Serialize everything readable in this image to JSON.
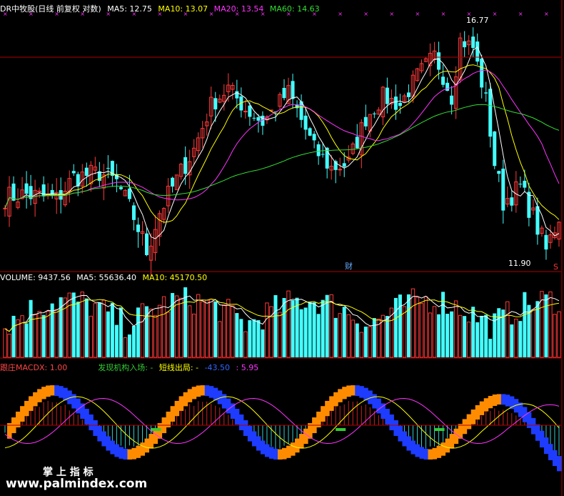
{
  "price_panel": {
    "title": "DR中牧股(日线 前复权 对数)",
    "legend": [
      {
        "label": "MA5: 12.75",
        "color": "#ffffff"
      },
      {
        "label": "MA10: 13.07",
        "color": "#ffff00"
      },
      {
        "label": "MA20: 13.54",
        "color": "#ff33ff"
      },
      {
        "label": "MA60: 14.63",
        "color": "#33dd33"
      }
    ],
    "high_label": "16.77",
    "low_label": "11.90",
    "finance_marker": "财",
    "corner_marker": "S"
  },
  "volume_panel": {
    "legend": [
      {
        "label": "VOLUME: 9437.56",
        "color": "#ffffff"
      },
      {
        "label": "MA5: 55636.40",
        "color": "#ffffff"
      },
      {
        "label": "MA10: 45170.50",
        "color": "#ffff00"
      }
    ]
  },
  "indicator_panel": {
    "legend": [
      {
        "label": "跟庄MACDX: 1.00",
        "color": "#ff4444"
      },
      {
        "label": "发现机构入场: -",
        "color": "#33cc33"
      },
      {
        "label": "短线出局: -",
        "color": "#ffff00"
      },
      {
        "label": "-43.50",
        "color": "#3366ff"
      },
      {
        "label": ": 5.95",
        "color": "#ff33ff"
      }
    ]
  },
  "watermark": {
    "line1": "掌 上 指 标",
    "line2": "www.palmindex.com"
  },
  "colors": {
    "up": "#ff3a3a",
    "down": "#44ffff",
    "axis": "#b00000",
    "orange": "#ff8c00",
    "blue": "#1e3cff",
    "green": "#33cc33",
    "magenta": "#ff33ff",
    "yellow": "#ffff00"
  },
  "chart_data": {
    "type": "candlestick",
    "scale": "log",
    "n_bars": 130,
    "price_extremes": {
      "high": 16.77,
      "low": 11.9
    },
    "moving_averages": {
      "MA5": 12.75,
      "MA10": 13.07,
      "MA20": 13.54,
      "MA60": 14.63
    },
    "volume": {
      "VOLUME": 9437.56,
      "MA5": 55636.4,
      "MA10": 45170.5
    },
    "indicator": {
      "跟庄MACDX": 1.0,
      "value_a": -43.5,
      "value_b": 5.95
    },
    "close_path": [
      [
        0,
        13.0
      ],
      [
        5,
        13.05
      ],
      [
        12,
        12.95
      ],
      [
        16,
        13.4
      ],
      [
        22,
        13.5
      ],
      [
        26,
        13.3
      ],
      [
        30,
        12.6
      ],
      [
        33,
        11.95
      ],
      [
        36,
        12.7
      ],
      [
        40,
        13.35
      ],
      [
        44,
        14.0
      ],
      [
        48,
        15.0
      ],
      [
        52,
        15.4
      ],
      [
        56,
        14.9
      ],
      [
        60,
        14.6
      ],
      [
        66,
        15.3
      ],
      [
        72,
        14.0
      ],
      [
        76,
        13.6
      ],
      [
        80,
        13.7
      ],
      [
        84,
        14.7
      ],
      [
        88,
        15.2
      ],
      [
        92,
        15.0
      ],
      [
        96,
        15.7
      ],
      [
        100,
        16.2
      ],
      [
        104,
        15.2
      ],
      [
        106,
        16.6
      ],
      [
        109,
        16.4
      ],
      [
        112,
        15.1
      ],
      [
        114,
        13.7
      ],
      [
        116,
        12.9
      ],
      [
        120,
        13.2
      ],
      [
        124,
        12.4
      ],
      [
        126,
        11.95
      ],
      [
        130,
        12.85
      ]
    ]
  }
}
